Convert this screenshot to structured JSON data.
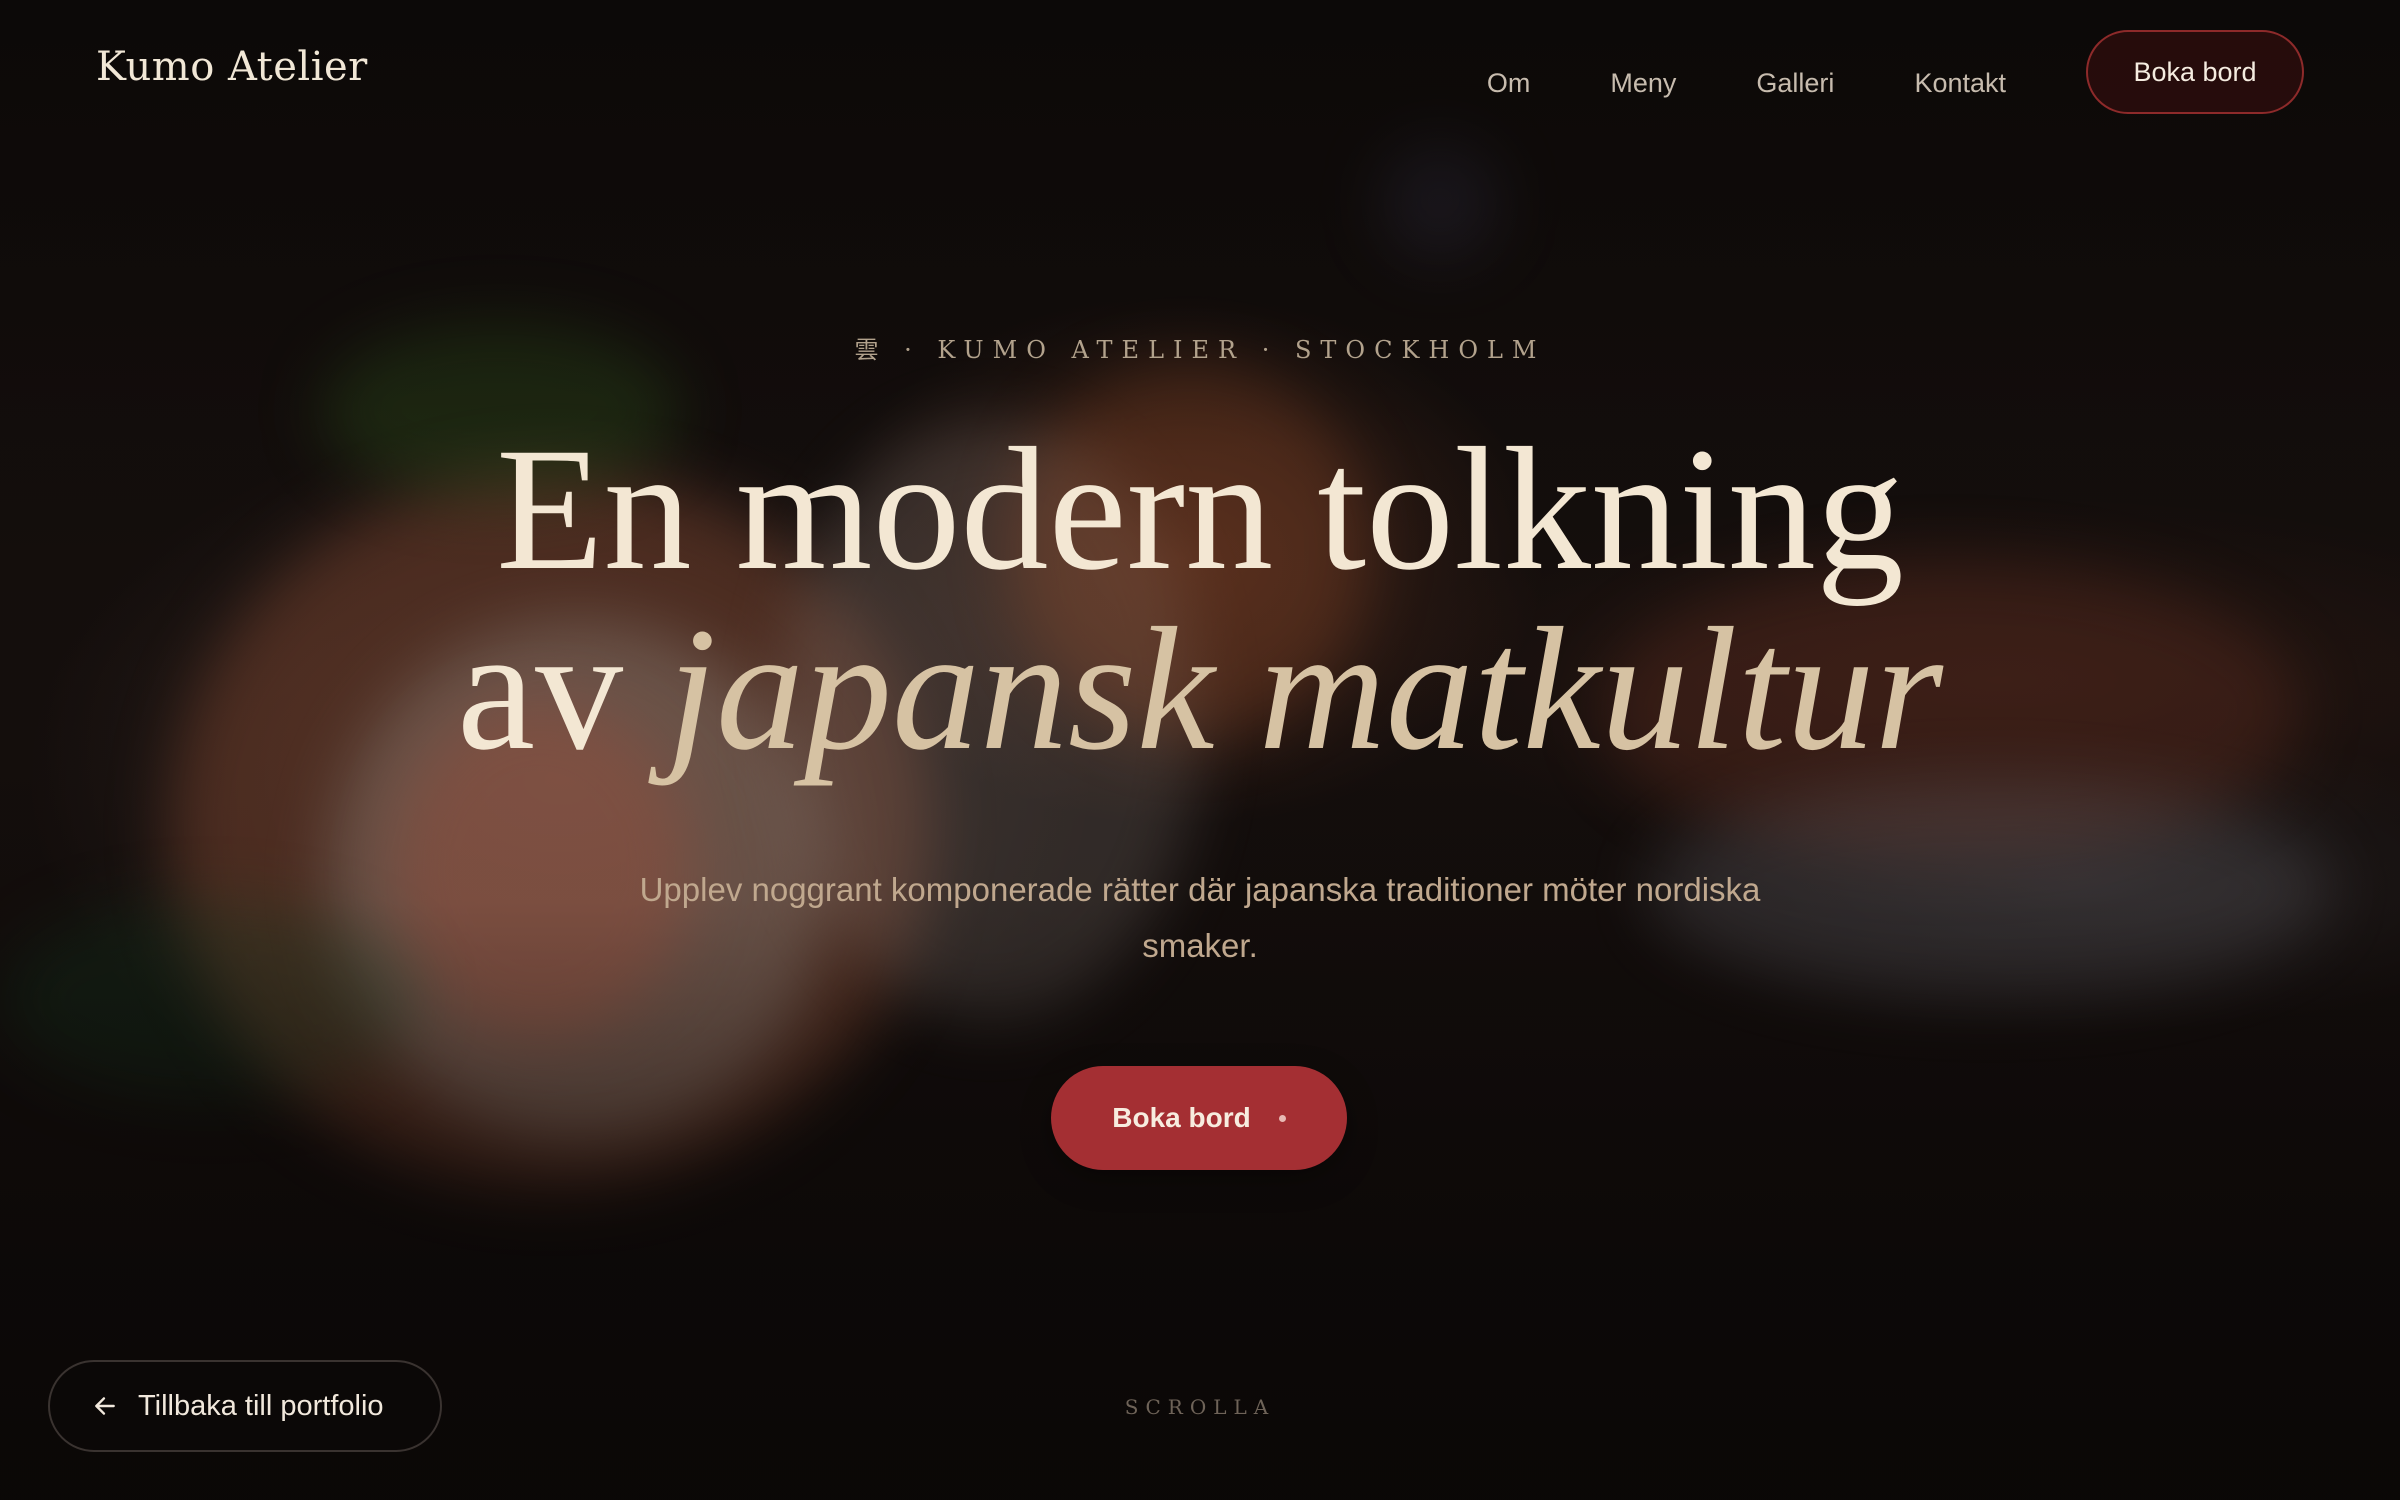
{
  "header": {
    "logo": "Kumo Atelier",
    "nav": [
      "Om",
      "Meny",
      "Galleri",
      "Kontakt"
    ],
    "cta_label": "Boka bord"
  },
  "hero": {
    "eyebrow": "雲 · KUMO ATELIER · STOCKHOLM",
    "headline_line1": "En modern tolkning",
    "headline_line2_prefix": "av ",
    "headline_line2_italic": "japansk matkultur",
    "subtitle": "Upplev noggrant komponerade rätter där japanska traditioner möter nordiska smaker.",
    "cta_label": "Boka bord"
  },
  "footer": {
    "back_label": "Tillbaka till portfolio",
    "scroll_label": "SCROLLA"
  },
  "colors": {
    "accent": "#a42f33",
    "text_cream": "#f3e7d3",
    "text_gold": "#d6c2a3",
    "background": "#0c0908"
  },
  "icons": {
    "back": "arrow-left-icon"
  }
}
